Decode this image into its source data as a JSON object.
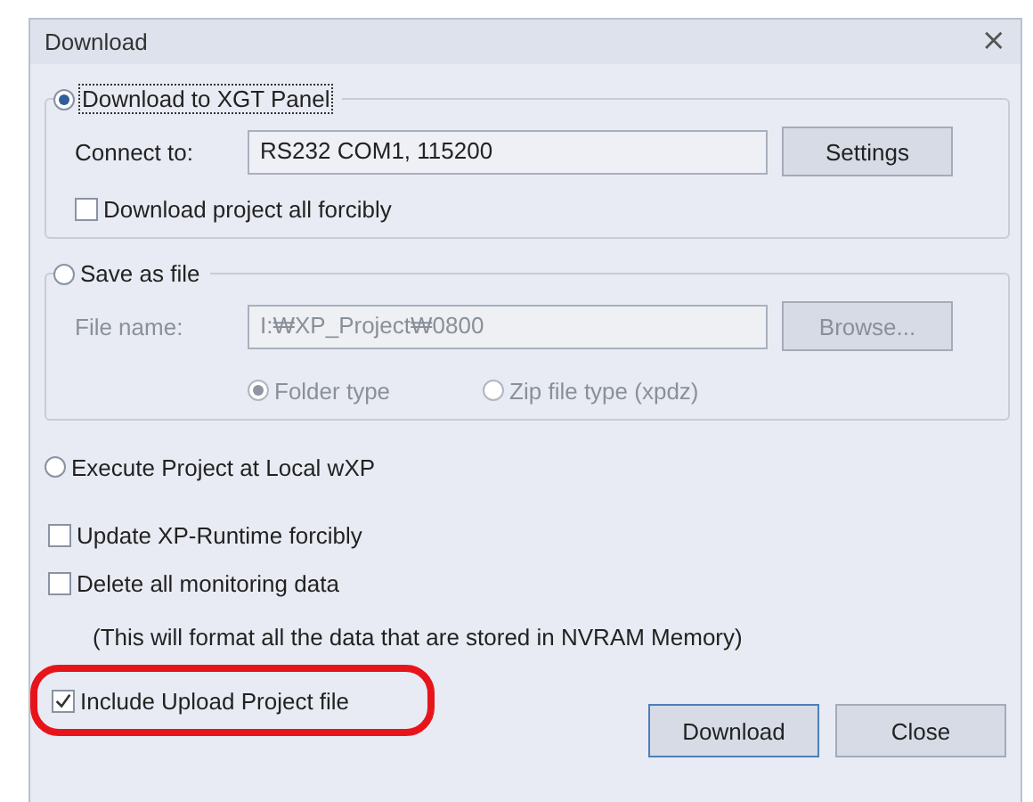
{
  "window": {
    "title": "Download",
    "close": "×"
  },
  "groups": [
    {
      "label": "Download to XGT Panel",
      "selected": true,
      "focused": true,
      "field_label": "Connect to:",
      "field_value": "RS232 COM1, 115200",
      "button": "Settings",
      "disabled": false,
      "options": [
        {
          "kind": "checkbox",
          "label": "Download project all forcibly",
          "checked": false
        }
      ]
    },
    {
      "label": "Save as file",
      "selected": false,
      "focused": false,
      "field_label": "File name:",
      "field_value": "I:₩XP_Project₩0800",
      "button": "Browse...",
      "disabled": true,
      "options": [
        {
          "kind": "radio",
          "label": "Folder type",
          "selected": true
        },
        {
          "kind": "radio",
          "label": "Zip file type (xpdz)",
          "selected": false
        }
      ]
    }
  ],
  "execute": {
    "label": "Execute Project at Local wXP",
    "selected": false
  },
  "options": [
    {
      "kind": "checkbox",
      "label": "Update XP-Runtime forcibly",
      "checked": false,
      "highlighted": false
    },
    {
      "kind": "checkbox",
      "label": "Delete all monitoring data",
      "checked": false,
      "highlighted": false
    },
    {
      "kind": "note",
      "label": "(This will format all the data that are stored in NVRAM Memory)"
    },
    {
      "kind": "checkbox",
      "label": "Include Upload Project file",
      "checked": true,
      "highlighted": true
    }
  ],
  "buttons": [
    {
      "label": "Download",
      "default": true
    },
    {
      "label": "Close",
      "default": false
    }
  ]
}
